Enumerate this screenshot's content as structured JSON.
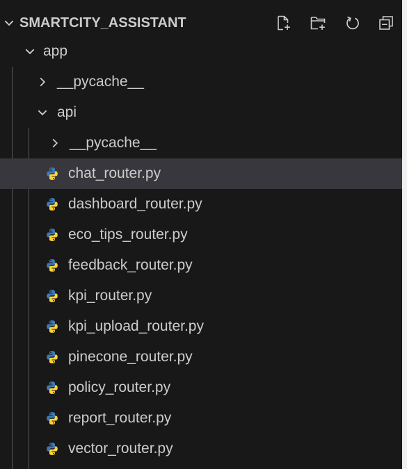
{
  "explorer": {
    "title": "SMARTCITY_ASSISTANT",
    "actions": [
      {
        "name": "new-file-icon"
      },
      {
        "name": "new-folder-icon"
      },
      {
        "name": "refresh-icon"
      },
      {
        "name": "collapse-all-icon"
      }
    ]
  },
  "tree": {
    "app": {
      "label": "app"
    },
    "app_pycache": {
      "label": "__pycache__"
    },
    "api": {
      "label": "api"
    },
    "api_pycache": {
      "label": "__pycache__"
    },
    "files": [
      {
        "label": "chat_router.py"
      },
      {
        "label": "dashboard_router.py"
      },
      {
        "label": "eco_tips_router.py"
      },
      {
        "label": "feedback_router.py"
      },
      {
        "label": "kpi_router.py"
      },
      {
        "label": "kpi_upload_router.py"
      },
      {
        "label": "pinecone_router.py"
      },
      {
        "label": "policy_router.py"
      },
      {
        "label": "report_router.py"
      },
      {
        "label": "vector_router.py"
      }
    ]
  },
  "colors": {
    "background": "#181818",
    "text": "#cccccc",
    "selected": "#37373d",
    "python_blue": "#3d7ab6",
    "python_yellow": "#ffd43b"
  }
}
